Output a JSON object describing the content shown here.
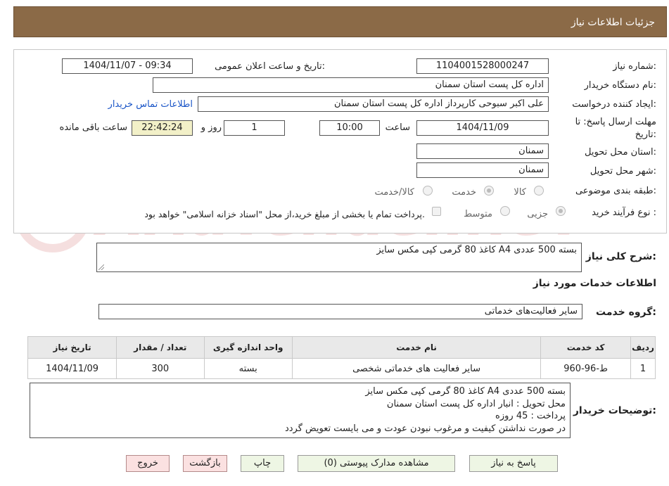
{
  "header": {
    "title": "جزئیات اطلاعات نیاز"
  },
  "fields": {
    "need_number_label": "شماره نیاز:",
    "need_number": "1104001528000247",
    "announce_label": "تاریخ و ساعت اعلان عمومی:",
    "announce_value": "1404/11/07 - 09:34",
    "buyer_org_label": "نام دستگاه خریدار:",
    "buyer_org": "اداره کل پست استان سمنان",
    "creator_label": "ایجاد کننده درخواست:",
    "creator": "علی اکبر سبوحی کارپرداز اداره کل پست استان سمنان",
    "contact_link": "اطلاعات تماس خریدار",
    "deadline_label_1": "مهلت ارسال پاسخ: تا",
    "deadline_label_2": "تاریخ:",
    "deadline_date": "1404/11/09",
    "hour_label": "ساعت",
    "deadline_time": "10:00",
    "days_value": "1",
    "days_label": "روز و",
    "remaining_time": "22:42:24",
    "remaining_label": "ساعت باقی مانده",
    "province_label": "استان محل تحویل:",
    "province": "سمنان",
    "city_label": "شهر محل تحویل:",
    "city": "سمنان",
    "category_label": "طبقه بندی موضوعی:",
    "category_options": [
      "کالا",
      "خدمت",
      "کالا/خدمت"
    ],
    "process_label": "نوع فرآیند خرید :",
    "process_options": [
      "جزیی",
      "متوسط"
    ],
    "treasury_note": "پرداخت تمام یا بخشی از مبلغ خرید،از محل \"اسناد خزانه اسلامی\" خواهد بود."
  },
  "description": {
    "label": "شرح کلی نیاز:",
    "value": "کاغذ 80 گرمی کپی مکس سایز A4 بسته 500 عددی"
  },
  "services": {
    "section_title": "اطلاعات خدمات مورد نیاز",
    "group_label": "گروه خدمت:",
    "group_value": "سایر فعالیت‌های خدماتی",
    "columns": [
      "ردیف",
      "کد خدمت",
      "نام خدمت",
      "واحد اندازه گیری",
      "تعداد / مقدار",
      "تاریخ نیاز"
    ],
    "rows": [
      [
        "1",
        "ط-96-960",
        "سایر فعالیت های خدماتی شخصی",
        "بسته",
        "300",
        "1404/11/09"
      ]
    ]
  },
  "buyer_notes": {
    "label": "توضیحات خریدار:",
    "lines": [
      "کاغذ 80 گرمی کپی مکس سایز A4 بسته 500 عددی",
      "محل تحویل : انبار اداره کل پست استان سمنان",
      "پرداخت : 45 روزه",
      "در صورت نداشتن کیفیت و مرغوب نبودن عودت و می بایست تعویض گردد"
    ]
  },
  "buttons": {
    "reply": "پاسخ به نیاز",
    "attachments": "مشاهده مدارک پیوستی (0)",
    "print": "چاپ",
    "back": "بازگشت",
    "exit": "خروج"
  },
  "watermark": "AriaTender.neT",
  "colors": {
    "header_bg": "#8b6a47",
    "link": "#1a55c7",
    "button_green": "#eef6e4",
    "button_red": "#fbe1e1",
    "time_bg": "#f2f0c8"
  }
}
